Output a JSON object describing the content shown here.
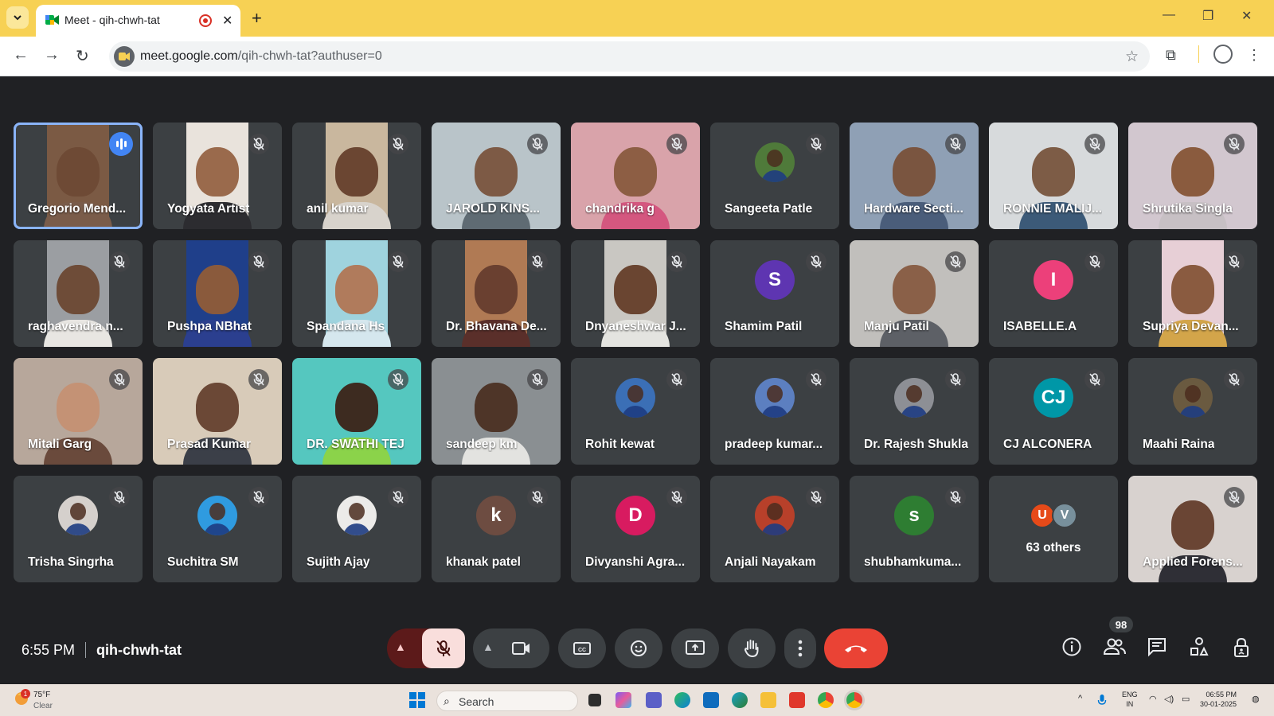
{
  "browser": {
    "tab": {
      "title": "Meet - qih-chwh-tat"
    },
    "url_host": "meet.google.com",
    "url_path": "/qih-chwh-tat?authuser=0"
  },
  "colors": {
    "accent": "#8ab4f8",
    "speaking": "#4285f4",
    "end_call": "#ea4335",
    "tile_bg": "#3c4043",
    "chrome_tabbar": "#f7d154"
  },
  "participants": [
    {
      "name": "Gregorio Mend...",
      "type": "video",
      "speaking": true,
      "skin": "#6e4a35",
      "shirt": "#7a5c4a",
      "bg": "#7b5a44"
    },
    {
      "name": "Yogyata Artist",
      "type": "video",
      "skin": "#9a6a4c",
      "shirt": "#2c2c30",
      "bg": "#e9e3dc"
    },
    {
      "name": "anil kumar",
      "type": "video",
      "skin": "#6b4632",
      "shirt": "#d8d3cc",
      "bg": "#c9b79e"
    },
    {
      "name": "JAROLD KINS...",
      "type": "video",
      "full": true,
      "skin": "#7d5a45",
      "shirt": "#5f6b73",
      "bg": "#b9c4c9"
    },
    {
      "name": "chandrika g",
      "type": "video",
      "full": true,
      "skin": "#8d5e44",
      "shirt": "#d4577f",
      "bg": "#d9a3aa"
    },
    {
      "name": "Sangeeta Patle",
      "type": "avatar",
      "avatar_color": "#4f7a3a",
      "photo": true
    },
    {
      "name": "Hardware Secti...",
      "type": "video",
      "full": true,
      "skin": "#7a5540",
      "shirt": "#4a5d7a",
      "bg": "#8fa0b5"
    },
    {
      "name": "RONNIE MALIJ...",
      "type": "video",
      "full": true,
      "skin": "#7d5c46",
      "shirt": "#3c5a78",
      "bg": "#d7dadc"
    },
    {
      "name": "Shrutika Singla",
      "type": "video",
      "full": true,
      "skin": "#8a5b3e",
      "shirt": "#c7c0c4",
      "bg": "#d2c7cf"
    },
    {
      "name": "raghavendra n...",
      "type": "video",
      "skin": "#6e4c38",
      "shirt": "#e8e6e2",
      "bg": "#9b9ea2"
    },
    {
      "name": "Pushpa NBhat",
      "type": "video",
      "skin": "#8a5a3c",
      "shirt": "#2b3f8f",
      "bg": "#1f3f8a"
    },
    {
      "name": "Spandana Hs",
      "type": "video",
      "skin": "#b07b5c",
      "shirt": "#d5e7ee",
      "bg": "#9fd3de"
    },
    {
      "name": "Dr. Bhavana De...",
      "type": "video",
      "skin": "#6a4030",
      "shirt": "#5a2f2a",
      "bg": "#b07a54"
    },
    {
      "name": "Dnyaneshwar J...",
      "type": "video",
      "skin": "#6a4531",
      "shirt": "#e4e4e0",
      "bg": "#c9c7c2"
    },
    {
      "name": "Shamim Patil",
      "type": "avatar",
      "letter": "S",
      "avatar_color": "#5e35b1"
    },
    {
      "name": "Manju Patil",
      "type": "video",
      "full": true,
      "skin": "#8a6048",
      "shirt": "#5d6066",
      "bg": "#c1bfbc"
    },
    {
      "name": "ISABELLE.A",
      "type": "avatar",
      "letter": "I",
      "avatar_color": "#ec407a"
    },
    {
      "name": "Supriya Devan...",
      "type": "video",
      "skin": "#8a5b40",
      "shirt": "#d3a54a",
      "bg": "#e7cfd6"
    },
    {
      "name": "Mitali Garg",
      "type": "video",
      "full": true,
      "skin": "#c49275",
      "shirt": "#6a4a3c",
      "bg": "#b7a79b"
    },
    {
      "name": "Prasad Kumar",
      "type": "video",
      "full": true,
      "skin": "#6b4836",
      "shirt": "#3b3f48",
      "bg": "#d8cbb9"
    },
    {
      "name": "DR. SWATHI TEJ",
      "type": "video",
      "full": true,
      "skin": "#3d2b20",
      "shirt": "#8bd34a",
      "bg": "#55c7bf"
    },
    {
      "name": "sandeep km",
      "type": "video",
      "full": true,
      "skin": "#4e3528",
      "shirt": "#e3e3e0",
      "bg": "#8a8f92"
    },
    {
      "name": "Rohit kewat",
      "type": "avatar",
      "avatar_color": "#3b6fb6",
      "photo": true
    },
    {
      "name": "pradeep kumar...",
      "type": "avatar",
      "avatar_color": "#5c7fc0",
      "photo": true
    },
    {
      "name": "Dr. Rajesh Shukla",
      "type": "avatar",
      "avatar_color": "#8d8f95",
      "photo": true
    },
    {
      "name": "CJ ALCONERA",
      "type": "avatar",
      "letter": "CJ",
      "avatar_color": "#0097a7"
    },
    {
      "name": "Maahi Raina",
      "type": "avatar",
      "avatar_color": "#6a5a40",
      "photo": true
    },
    {
      "name": "Trisha Singrha",
      "type": "avatar",
      "avatar_color": "#d5d0cc",
      "photo": true
    },
    {
      "name": "Suchitra SM",
      "type": "avatar",
      "avatar_color": "#2f9be0",
      "photo": true
    },
    {
      "name": "Sujith Ajay",
      "type": "avatar",
      "avatar_color": "#ecebe9",
      "photo": true
    },
    {
      "name": "khanak patel",
      "type": "avatar",
      "letter": "k",
      "avatar_color": "#6d4c41"
    },
    {
      "name": "Divyanshi Agra...",
      "type": "avatar",
      "letter": "D",
      "avatar_color": "#d81b60"
    },
    {
      "name": "Anjali Nayakam",
      "type": "avatar",
      "avatar_color": "#b8402a",
      "photo": true
    },
    {
      "name": "shubhamkuma...",
      "type": "avatar",
      "letter": "s",
      "avatar_color": "#2e7d32"
    },
    {
      "name": "others",
      "type": "others",
      "label": "63 others",
      "letters": [
        "U",
        "V"
      ],
      "letter_colors": [
        "#e64a19",
        "#78909c"
      ]
    },
    {
      "name": "Applied Forens...",
      "type": "video",
      "full": true,
      "skin": "#6a4534",
      "shirt": "#2f2f36",
      "bg": "#d8d2cf"
    }
  ],
  "meeting": {
    "time": "6:55 PM",
    "code": "qih-chwh-tat",
    "people_count": "98"
  },
  "icons": [
    "microphone-off-icon",
    "camera-icon",
    "captions-icon",
    "emoji-icon",
    "present-icon",
    "raise-hand-icon",
    "more-options-icon",
    "end-call-icon",
    "info-icon",
    "people-icon",
    "chat-icon",
    "activities-icon",
    "host-controls-icon"
  ],
  "taskbar": {
    "weather_temp": "75°F",
    "weather_desc": "Clear",
    "weather_badge": "1",
    "search_placeholder": "Search",
    "lang_top": "ENG",
    "lang_bottom": "IN",
    "clock_time": "06:55 PM",
    "clock_date": "30-01-2025"
  }
}
